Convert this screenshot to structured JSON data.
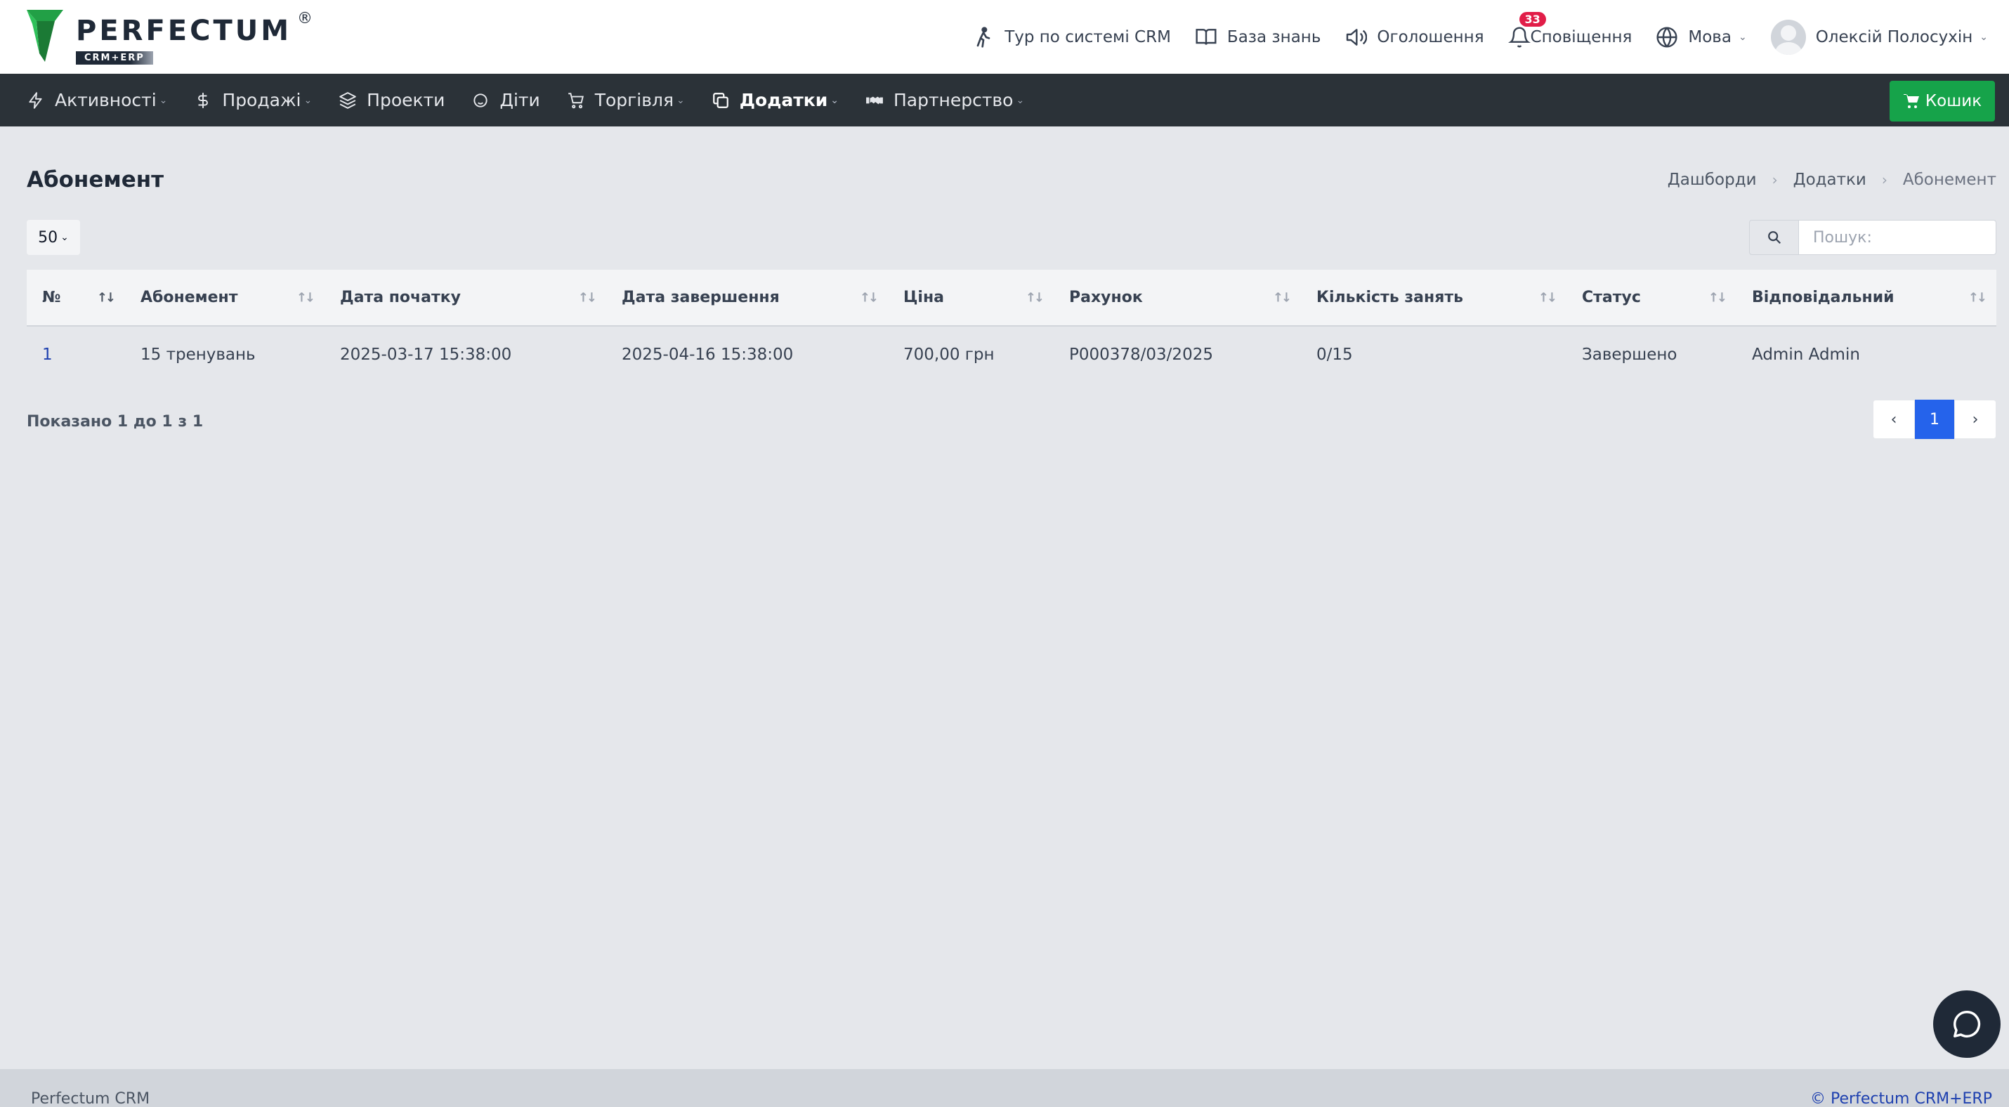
{
  "app": {
    "logo_word": "PERFECTUM",
    "logo_sub": "CRM+ERP",
    "logo_reg": "®",
    "brand_color": "#16a34a"
  },
  "top_nav": {
    "tour": "Тур по системі CRM",
    "knowledge": "База знань",
    "announcements": "Оголошення",
    "notifications": "Сповіщення",
    "notifications_count": "33",
    "language": "Мова",
    "user_name": "Олексій Полосухін"
  },
  "main_nav": {
    "items": [
      {
        "label": "Активності",
        "icon": "bolt-icon"
      },
      {
        "label": "Продажі",
        "icon": "dollar-icon"
      },
      {
        "label": "Проекти",
        "icon": "layers-icon"
      },
      {
        "label": "Діти",
        "icon": "child-icon"
      },
      {
        "label": "Торгівля",
        "icon": "cart-icon"
      },
      {
        "label": "Додатки",
        "icon": "copy-icon"
      },
      {
        "label": "Партнерство",
        "icon": "handshake-icon"
      }
    ],
    "cart_button": "Кошик"
  },
  "page": {
    "title": "Абонемент",
    "breadcrumb": [
      "Дашборди",
      "Додатки",
      "Абонемент"
    ],
    "page_size": "50",
    "search_placeholder": "Пошук:"
  },
  "table": {
    "headers": [
      "№",
      "Абонемент",
      "Дата початку",
      "Дата завершення",
      "Ціна",
      "Рахунок",
      "Кількість занять",
      "Статус",
      "Відповідальний"
    ],
    "rows": [
      [
        "1",
        "15 тренувань",
        "2025-03-17 15:38:00",
        "2025-04-16 15:38:00",
        "700,00 грн",
        "P000378/03/2025",
        "0/15",
        "Завершено",
        "Admin Admin"
      ]
    ]
  },
  "pagination": {
    "info": "Показано 1 до 1 з 1",
    "prev": "‹",
    "current": "1",
    "next": "›"
  },
  "footer": {
    "left": "Perfectum CRM",
    "right": "© Perfectum CRM+ERP"
  }
}
